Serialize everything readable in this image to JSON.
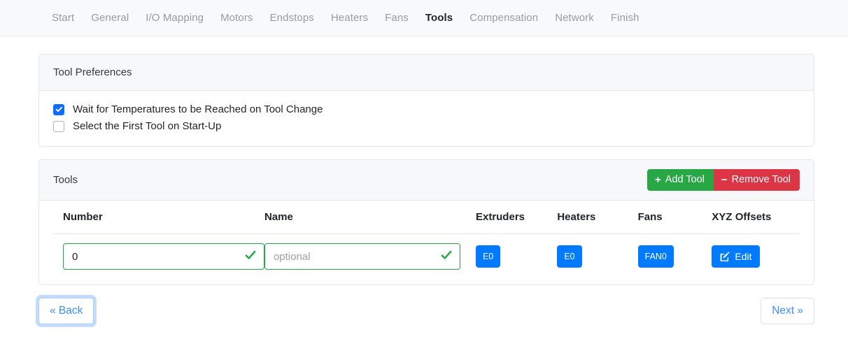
{
  "nav": {
    "items": [
      {
        "label": "Start",
        "active": false
      },
      {
        "label": "General",
        "active": false
      },
      {
        "label": "I/O Mapping",
        "active": false
      },
      {
        "label": "Motors",
        "active": false
      },
      {
        "label": "Endstops",
        "active": false
      },
      {
        "label": "Heaters",
        "active": false
      },
      {
        "label": "Fans",
        "active": false
      },
      {
        "label": "Tools",
        "active": true
      },
      {
        "label": "Compensation",
        "active": false
      },
      {
        "label": "Network",
        "active": false
      },
      {
        "label": "Finish",
        "active": false
      }
    ]
  },
  "preferences": {
    "title": "Tool Preferences",
    "options": [
      {
        "label": "Wait for Temperatures to be Reached on Tool Change",
        "checked": true
      },
      {
        "label": "Select the First Tool on Start-Up",
        "checked": false
      }
    ]
  },
  "tools": {
    "title": "Tools",
    "add_label": "Add Tool",
    "add_symbol": "+",
    "remove_label": "Remove Tool",
    "remove_symbol": "−",
    "columns": [
      "Number",
      "Name",
      "Extruders",
      "Heaters",
      "Fans",
      "XYZ Offsets"
    ],
    "rows": [
      {
        "number_value": "0",
        "number_placeholder": "",
        "name_value": "",
        "name_placeholder": "optional",
        "extruders": "E0",
        "heaters": "E0",
        "fans": "FAN0",
        "edit_label": "Edit"
      }
    ]
  },
  "footer": {
    "back_label": "« Back",
    "next_label": "Next »"
  },
  "colors": {
    "accent_blue": "#007bff",
    "success_green": "#28a745",
    "danger_red": "#dc3545",
    "checkbox_blue": "#0d6efd",
    "link_blue": "#3d8bfd"
  }
}
